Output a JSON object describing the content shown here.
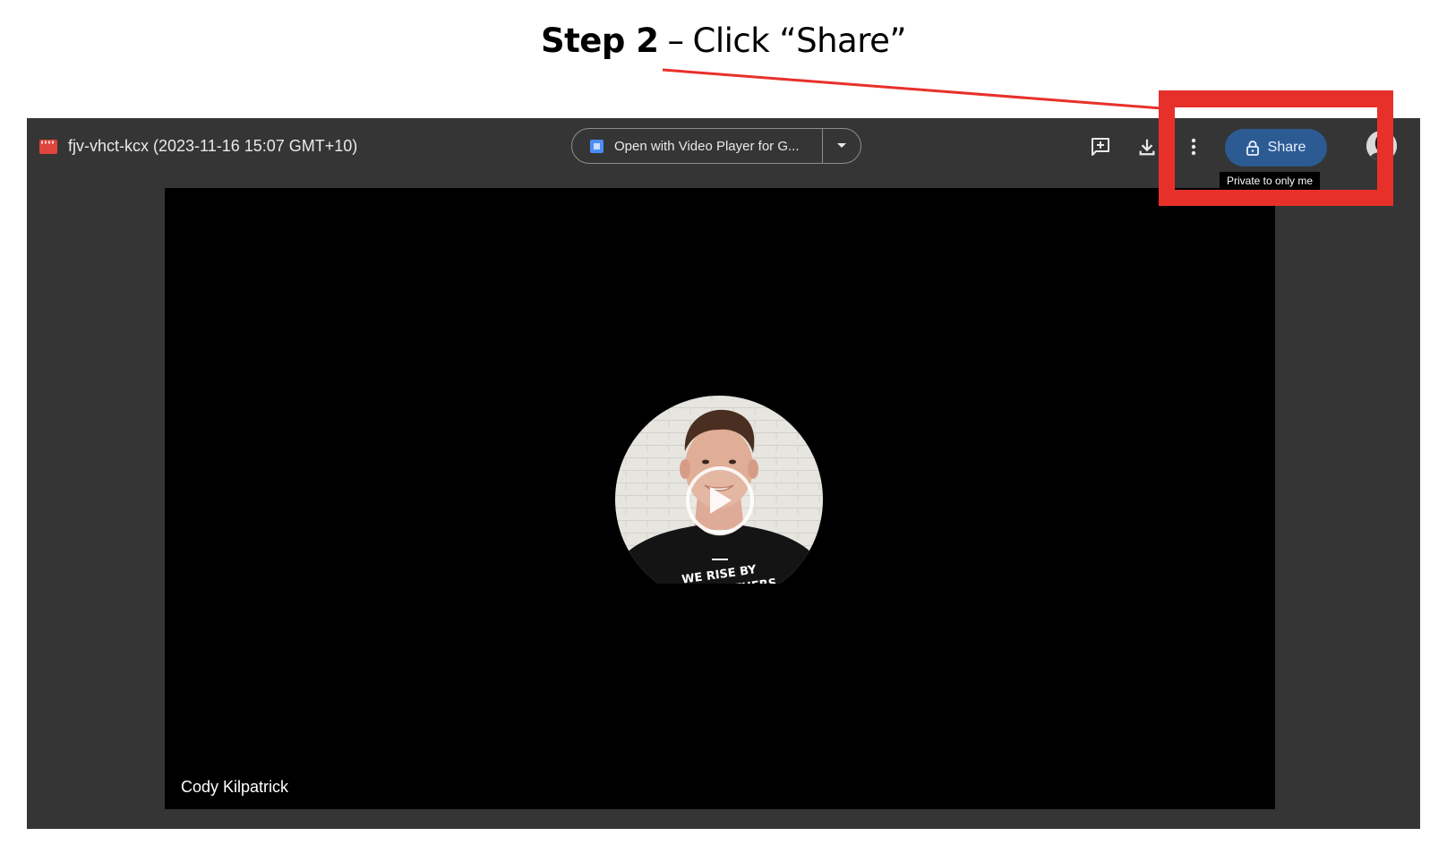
{
  "annotation": {
    "step_bold": "Step 2",
    "dash": "–",
    "step_text": "Click “Share”",
    "highlight_color": "#e8302a"
  },
  "toolbar": {
    "file_title": "fjv-vhct-kcx (2023-11-16 15:07 GMT+10)",
    "open_with_label": "Open with Video Player for G...",
    "share_label": "Share",
    "share_tooltip": "Private to only me",
    "icons": [
      "video-file-icon",
      "add-comment-icon",
      "download-icon",
      "more-vert-icon",
      "lock-icon",
      "caret-down-icon"
    ]
  },
  "video": {
    "speaker_name": "Cody Kilpatrick",
    "shirt_line1": "WE RISE BY",
    "shirt_line2": "LIFTING OTHERS"
  },
  "colors": {
    "viewer_bg": "#353535",
    "share_bg": "#2c5b94",
    "video_bg": "#000000"
  }
}
